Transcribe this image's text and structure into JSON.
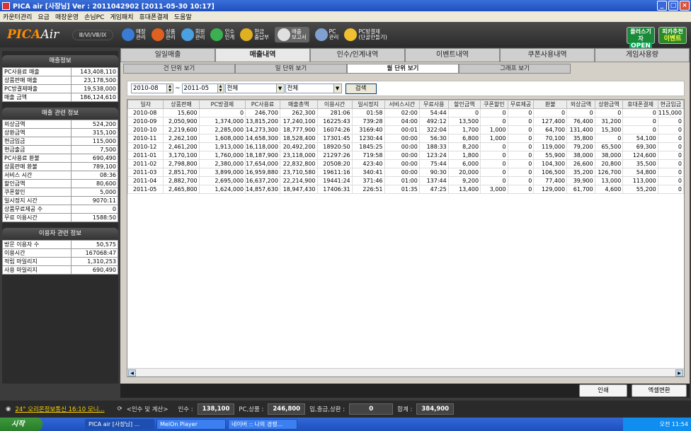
{
  "window": {
    "title": "PICA air [사장님]  Ver : 2011042902 [2011-05-30 10:17]"
  },
  "menu": [
    "카운터관리",
    "요금",
    "매장운영",
    "손님PC",
    "게임패치",
    "휴대폰결제",
    "도움말"
  ],
  "toolbar": {
    "logo_a": "PICA",
    "logo_b": "Air",
    "version": "Ⅲ/Ⅵ/Ⅷ/Ⅸ",
    "buttons": [
      {
        "l1": "매장",
        "l2": "관리",
        "icon": "monitor-icon",
        "color": "#3a7bd5"
      },
      {
        "l1": "상품",
        "l2": "관리",
        "icon": "food-icon",
        "color": "#e06020"
      },
      {
        "l1": "회원",
        "l2": "관리",
        "icon": "user-icon",
        "color": "#4aa0e0"
      },
      {
        "l1": "인수",
        "l2": "인계",
        "icon": "handover-icon",
        "color": "#3ab050"
      },
      {
        "l1": "현금",
        "l2": "출납부",
        "icon": "cash-icon",
        "color": "#e0b020"
      },
      {
        "l1": "매출",
        "l2": "보고서",
        "icon": "report-icon",
        "color": "#e0e0e0"
      },
      {
        "l1": "PC",
        "l2": "관리",
        "icon": "pc-tools-icon",
        "color": "#80a0d0"
      },
      {
        "l1": "PC방결제",
        "l2": "(단골만들기)",
        "icon": "payment-icon",
        "color": "#f0c030"
      }
    ],
    "badge1": "플러스기자",
    "badge1b": "OPEN",
    "badge2": "피카추천",
    "badge2b": "이벤트"
  },
  "sidebar": {
    "sales_title": "매출정보",
    "sales": [
      {
        "k": "PC사용료 매출",
        "v": "143,408,110"
      },
      {
        "k": "상품판매 매출",
        "v": "23,178,500"
      },
      {
        "k": "PC방결제매출",
        "v": "19,538,000"
      },
      {
        "k": "매출 금액",
        "v": "186,124,610"
      }
    ],
    "related_title": "매출 관련 정보",
    "related": [
      {
        "k": "외상금액",
        "v": "524,200"
      },
      {
        "k": "상환금액",
        "v": "315,100"
      },
      {
        "k": "현금입금",
        "v": "115,000"
      },
      {
        "k": "현금출금",
        "v": "7,500"
      },
      {
        "k": "PC사용료 환불",
        "v": "690,490"
      },
      {
        "k": "상품판매 환불",
        "v": "789,100"
      },
      {
        "k": "서비스 시간",
        "v": "08:36"
      },
      {
        "k": "할인금액",
        "v": "80,600"
      },
      {
        "k": "쿠폰할인",
        "v": "5,000"
      },
      {
        "k": "일시정지 시간",
        "v": "9070:11"
      },
      {
        "k": "상품무료제공 수",
        "v": "0"
      },
      {
        "k": "무료 이용시간",
        "v": "1588:50"
      }
    ],
    "user_title": "이용자 관련 정보",
    "user": [
      {
        "k": "방문 이용자 수",
        "v": "50,575"
      },
      {
        "k": "이용시간",
        "v": "167068:47"
      },
      {
        "k": "적립 마일리지",
        "v": "1,310,253"
      },
      {
        "k": "사용 마일리지",
        "v": "690,490"
      }
    ]
  },
  "tabs": [
    "일일매출",
    "매출내역",
    "인수/인계내역",
    "이벤트내역",
    "쿠폰사용내역",
    "게임사용량"
  ],
  "subtabs": [
    "건 단위 보기",
    "일 단위 보기",
    "월 단위 보기",
    "그래프 보기"
  ],
  "filter": {
    "from": "2010-08",
    "sep": "~",
    "to": "2011-05",
    "sel1": "전체",
    "sel2": "전체",
    "search": "검색"
  },
  "table": {
    "headers": [
      "일자",
      "상품판매",
      "PC방결제",
      "PC사용료",
      "매출총액",
      "이용시간",
      "일시정지",
      "서비스시간",
      "무료사용",
      "할인금액",
      "쿠폰할인",
      "무료제공",
      "환불",
      "외상금액",
      "상환금액",
      "휴대폰결제",
      "현금입금"
    ],
    "rows": [
      [
        "2010-08",
        "15,600",
        "0",
        "246,700",
        "262,300",
        "281:06",
        "01:58",
        "02:00",
        "54:44",
        "0",
        "0",
        "0",
        "0",
        "0",
        "0",
        "0",
        "115,000"
      ],
      [
        "2010-09",
        "2,050,900",
        "1,374,000",
        "13,815,200",
        "17,240,100",
        "16225:43",
        "739:28",
        "04:00",
        "492:12",
        "13,500",
        "0",
        "0",
        "127,400",
        "76,400",
        "31,200",
        "0",
        "0"
      ],
      [
        "2010-10",
        "2,219,600",
        "2,285,000",
        "14,273,300",
        "18,777,900",
        "16074:26",
        "3169:40",
        "00:01",
        "322:04",
        "1,700",
        "1,000",
        "0",
        "64,700",
        "131,400",
        "15,300",
        "0",
        "0"
      ],
      [
        "2010-11",
        "2,262,100",
        "1,608,000",
        "14,658,300",
        "18,528,400",
        "17301:45",
        "1230:44",
        "00:00",
        "56:30",
        "6,800",
        "1,000",
        "0",
        "70,100",
        "35,800",
        "0",
        "54,100",
        "0"
      ],
      [
        "2010-12",
        "2,461,200",
        "1,913,000",
        "16,118,000",
        "20,492,200",
        "18920:50",
        "1845:25",
        "00:00",
        "188:33",
        "8,200",
        "0",
        "0",
        "119,000",
        "79,200",
        "65,500",
        "69,300",
        "0"
      ],
      [
        "2011-01",
        "3,170,100",
        "1,760,000",
        "18,187,900",
        "23,118,000",
        "21297:26",
        "719:58",
        "00:00",
        "123:24",
        "1,800",
        "0",
        "0",
        "55,900",
        "38,000",
        "38,000",
        "124,600",
        "0"
      ],
      [
        "2011-02",
        "2,798,800",
        "2,380,000",
        "17,654,000",
        "22,832,800",
        "20508:20",
        "423:40",
        "00:00",
        "75:44",
        "6,000",
        "0",
        "0",
        "104,300",
        "26,600",
        "20,800",
        "35,500",
        "0"
      ],
      [
        "2011-03",
        "2,851,700",
        "3,899,000",
        "16,959,880",
        "23,710,580",
        "19611:16",
        "340:41",
        "00:00",
        "90:30",
        "20,000",
        "0",
        "0",
        "106,500",
        "35,200",
        "126,700",
        "54,800",
        "0"
      ],
      [
        "2011-04",
        "2,882,700",
        "2,695,000",
        "16,637,200",
        "22,214,900",
        "19441:24",
        "371:46",
        "01:00",
        "137:44",
        "9,200",
        "0",
        "0",
        "77,400",
        "39,900",
        "13,000",
        "113,000",
        "0"
      ],
      [
        "2011-05",
        "2,465,800",
        "1,624,000",
        "14,857,630",
        "18,947,430",
        "17406:31",
        "226:51",
        "01:35",
        "47:25",
        "13,400",
        "3,000",
        "0",
        "129,000",
        "61,700",
        "4,600",
        "55,200",
        "0"
      ]
    ]
  },
  "actions": {
    "print": "인쇄",
    "excel": "엑셀변환"
  },
  "status": {
    "ticker": "24° 오리온정보통신 16:10 모니...",
    "handover": "<인수 및 계산>",
    "l1": "인수 :",
    "v1": "138,100",
    "l2": "PC,상품 :",
    "v2": "246,800",
    "l3": "입,출금,상환 :",
    "v3": "0",
    "l4": "합계 :",
    "v4": "384,900"
  },
  "taskbar": {
    "start": "시작",
    "t1": "PICA air [사장님] ...",
    "t2": "MelOn Player",
    "t3": "네이버 :: 나의 경쟁...",
    "clock": "오전 11:54"
  }
}
